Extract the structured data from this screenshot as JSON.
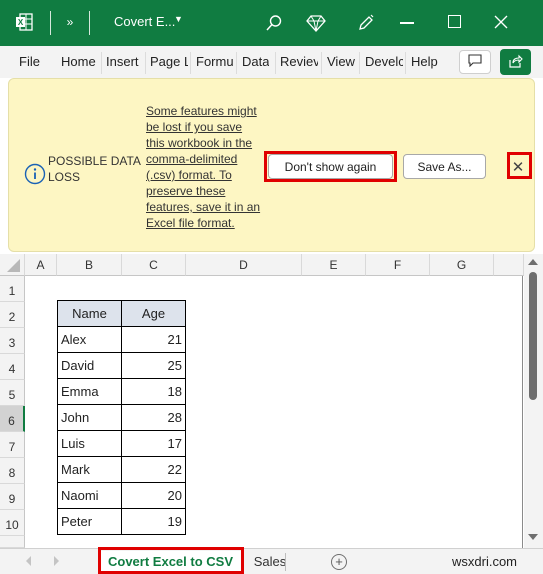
{
  "titlebar": {
    "app_icon": "excel-logo-icon",
    "more_label": "»",
    "file_name": "Covert E...",
    "icons": [
      "search-icon",
      "diamond-icon",
      "pen-icon",
      "minimize-icon",
      "maximize-icon",
      "close-icon"
    ]
  },
  "ribbon": {
    "tabs": [
      "File",
      "Home",
      "Insert",
      "Page L",
      "Formu",
      "Data",
      "Reviev",
      "View",
      "Develc",
      "Help"
    ],
    "comment_icon": "comment-icon",
    "share_icon": "share-icon"
  },
  "message_bar": {
    "title": "POSSIBLE DATA LOSS",
    "text": "Some features might be lost if you save this workbook in the comma-delimited (.csv) format. To preserve these features, save it in an Excel file format.",
    "dont_show_label": "Don't show again",
    "save_as_label": "Save As...",
    "close_label": "✕",
    "highlight_color": "#e00000"
  },
  "grid": {
    "columns": [
      "A",
      "B",
      "C",
      "D",
      "E",
      "F",
      "G"
    ],
    "rows": [
      "1",
      "2",
      "3",
      "4",
      "5",
      "6",
      "7",
      "8",
      "9",
      "10"
    ],
    "selected_row": "6"
  },
  "table": {
    "headers": [
      "Name",
      "Age"
    ],
    "rows": [
      [
        "Alex",
        "21"
      ],
      [
        "David",
        "25"
      ],
      [
        "Emma",
        "18"
      ],
      [
        "John",
        "28"
      ],
      [
        "Luis",
        "17"
      ],
      [
        "Mark",
        "22"
      ],
      [
        "Naomi",
        "20"
      ],
      [
        "Peter",
        "19"
      ]
    ]
  },
  "sheets": {
    "tabs": [
      "Covert Excel to CSV",
      "Sales"
    ],
    "active": "Covert Excel to CSV",
    "add_label": "+"
  },
  "watermark": "wsxdri.com",
  "colors": {
    "brand_green": "#107c41",
    "message_bg": "#fdf6c3",
    "table_header_bg": "#dde3ec"
  }
}
